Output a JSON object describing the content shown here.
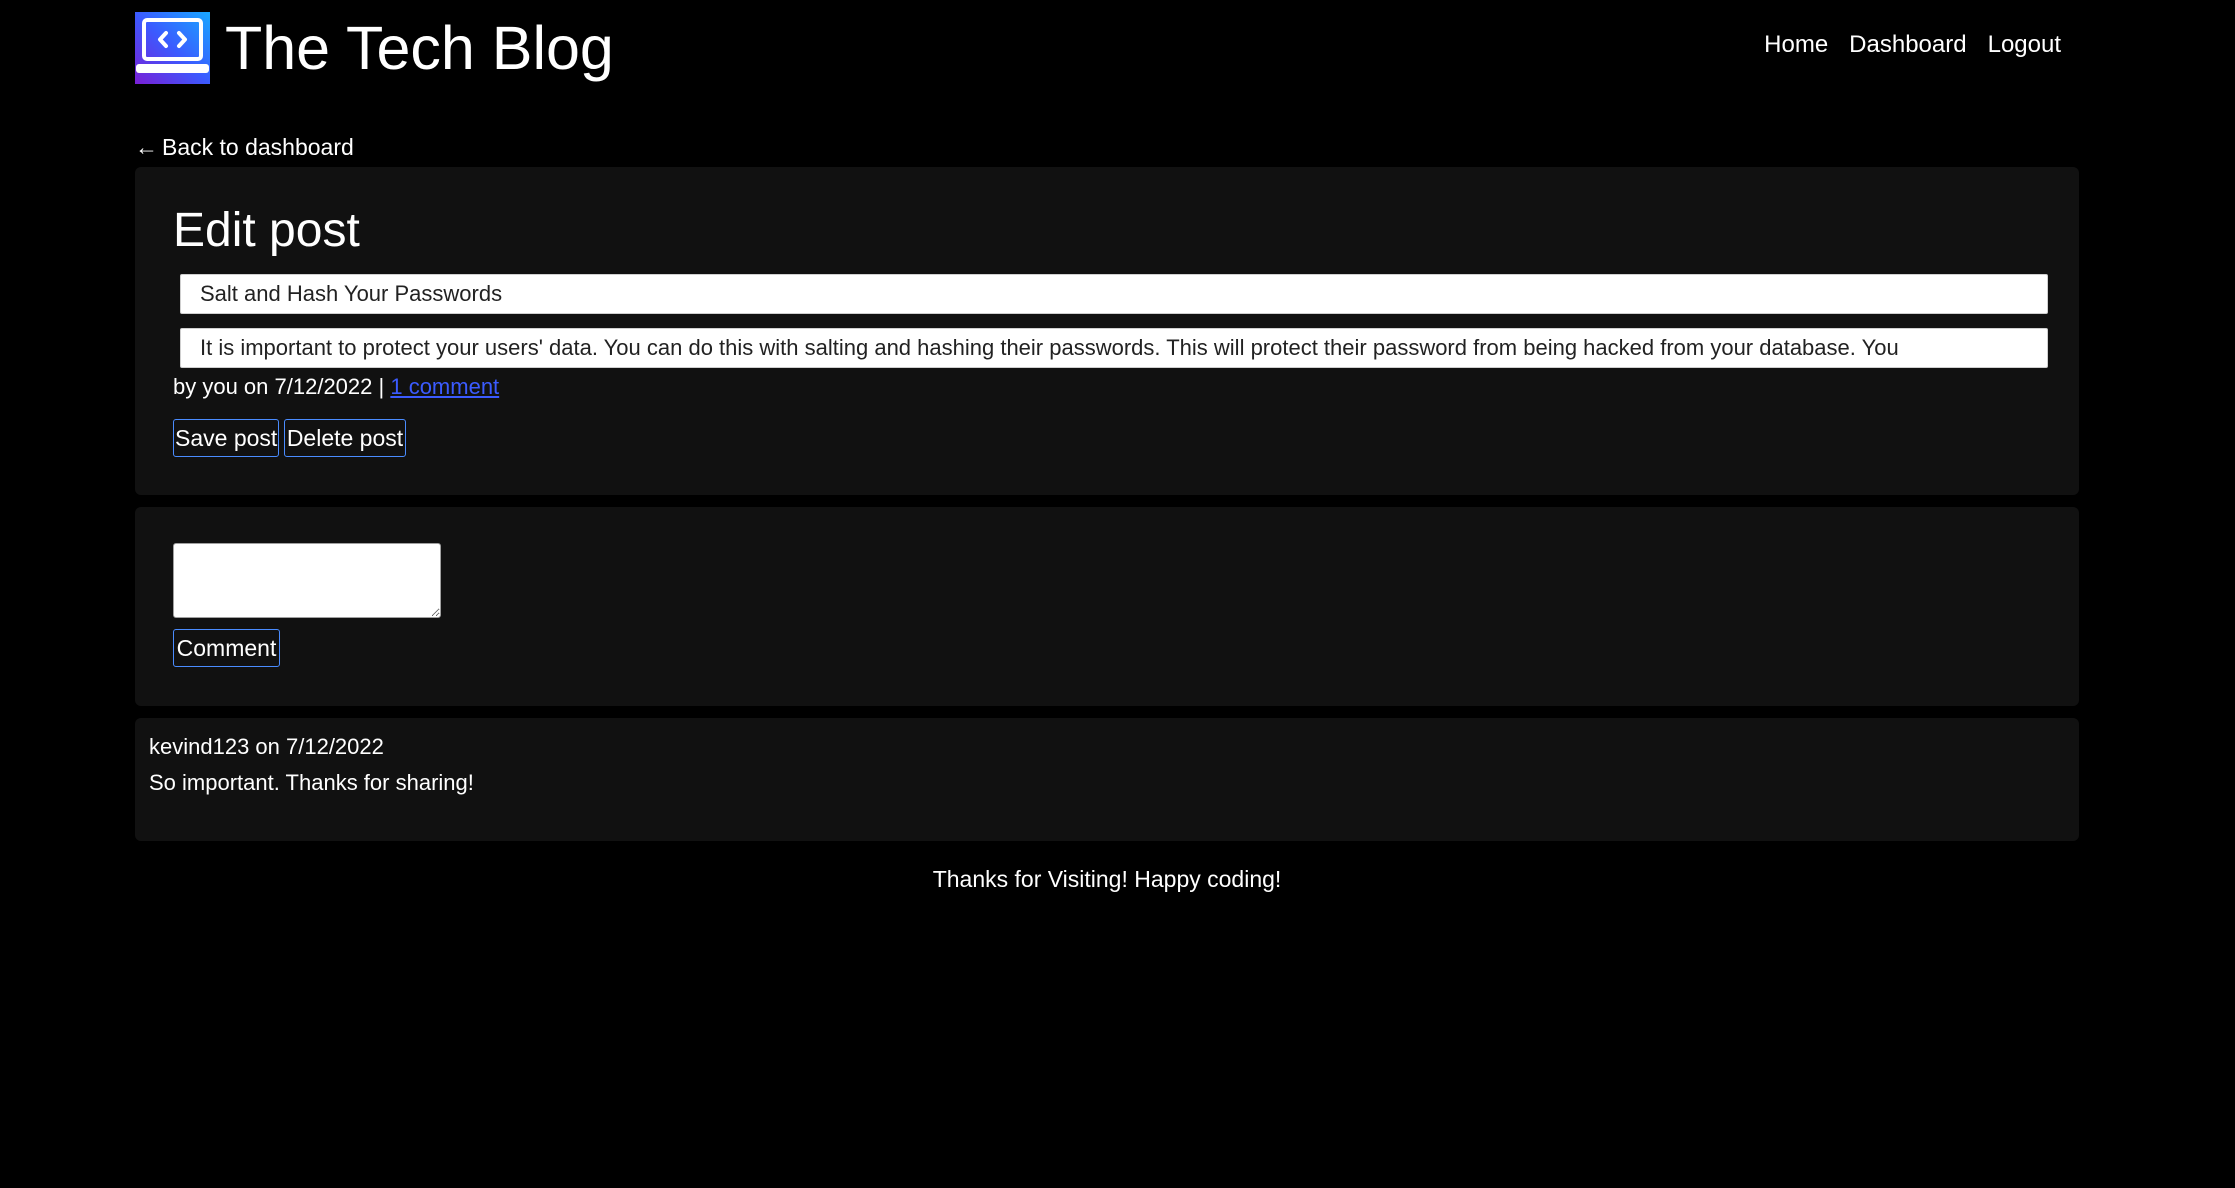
{
  "header": {
    "title": "The Tech Blog",
    "logo_icon": "laptop-code-icon",
    "nav": {
      "home": "Home",
      "dashboard": "Dashboard",
      "logout": "Logout"
    }
  },
  "back_link": {
    "arrow": "←",
    "label": "Back to dashboard"
  },
  "edit_post": {
    "heading": "Edit post",
    "title_value": "Salt and Hash Your Passwords",
    "content_value": "It is important to protect your users' data. You can do this with salting and hashing their passwords. This will protect their password from being hacked from your database. You",
    "meta_prefix": "by you on 7/12/2022 |",
    "comments_link": "1 comment",
    "save_label": "Save post",
    "delete_label": "Delete post"
  },
  "new_comment": {
    "textarea_value": "",
    "submit_label": "Comment"
  },
  "comments": [
    {
      "author_line": "kevind123 on 7/12/2022",
      "body": "So important. Thanks for sharing!"
    }
  ],
  "footer": {
    "text": "Thanks for Visiting! Happy coding!"
  },
  "colors": {
    "background": "#000000",
    "panel": "#111111",
    "link": "#3b5bff",
    "button_border": "#4a8cff",
    "logo_gradient_start": "#8a2be2",
    "logo_gradient_end": "#1e90ff"
  }
}
